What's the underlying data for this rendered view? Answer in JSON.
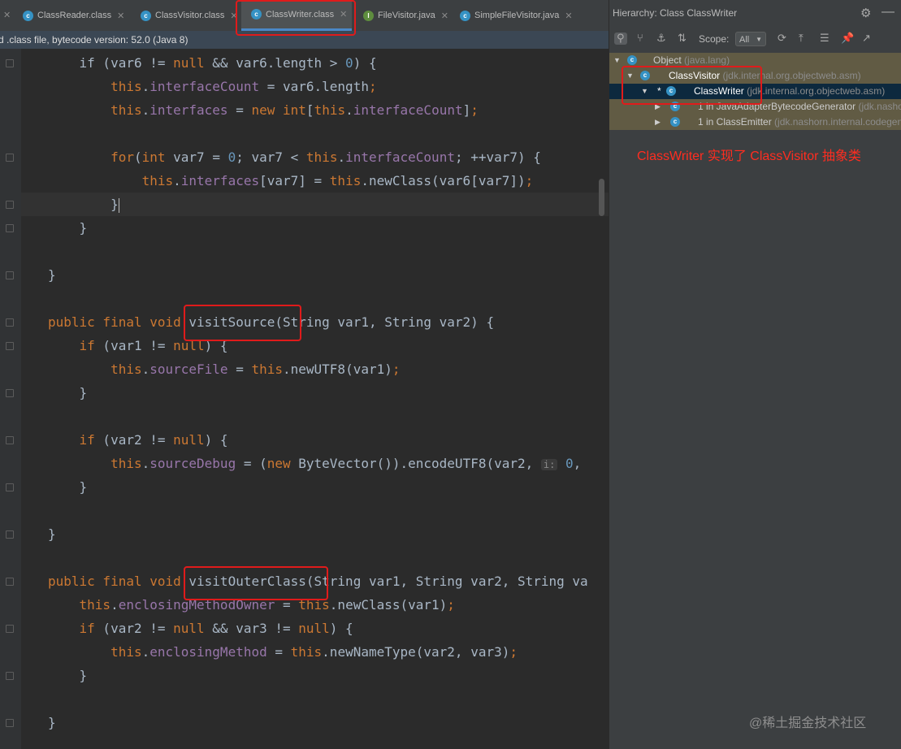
{
  "tabs": [
    {
      "label": "ClassReader.class",
      "kind": "class",
      "active": false
    },
    {
      "label": "ClassVisitor.class",
      "kind": "class",
      "active": false
    },
    {
      "label": "ClassWriter.class",
      "kind": "class",
      "active": true
    },
    {
      "label": "FileVisitor.java",
      "kind": "java",
      "active": false
    },
    {
      "label": "SimpleFileVisitor.java",
      "kind": "java",
      "active": false
    }
  ],
  "info_bar": "d .class file, bytecode version: 52.0 (Java 8)",
  "code_lines": [
    [
      [
        "    ",
        ""
      ],
      [
        "if",
        ""
      ],
      [
        " (var6 != ",
        ""
      ],
      [
        "null",
        "k"
      ],
      [
        " && var6.length > ",
        ""
      ],
      [
        "0",
        "n"
      ],
      [
        ") {",
        ""
      ]
    ],
    [
      [
        "        ",
        ""
      ],
      [
        "this",
        "k"
      ],
      [
        ".",
        ""
      ],
      [
        "interfaceCount",
        "f"
      ],
      [
        " = var6.length",
        ""
      ],
      [
        ";",
        "k"
      ]
    ],
    [
      [
        "        ",
        ""
      ],
      [
        "this",
        "k"
      ],
      [
        ".",
        ""
      ],
      [
        "interfaces",
        "f"
      ],
      [
        " = ",
        ""
      ],
      [
        "new",
        "k"
      ],
      [
        " ",
        ""
      ],
      [
        "int",
        "k"
      ],
      [
        "[",
        ""
      ],
      [
        "this",
        "k"
      ],
      [
        ".",
        ""
      ],
      [
        "interfaceCount",
        "f"
      ],
      [
        "]",
        ""
      ],
      [
        ";",
        "k"
      ]
    ],
    [],
    [
      [
        "        ",
        ""
      ],
      [
        "for",
        "k"
      ],
      [
        "(",
        ""
      ],
      [
        "int",
        "k"
      ],
      [
        " var7 = ",
        ""
      ],
      [
        "0",
        "n"
      ],
      [
        "; var7 < ",
        ""
      ],
      [
        "this",
        "k"
      ],
      [
        ".",
        ""
      ],
      [
        "interfaceCount",
        "f"
      ],
      [
        "; ++var7) {",
        ""
      ]
    ],
    [
      [
        "            ",
        ""
      ],
      [
        "this",
        "k"
      ],
      [
        ".",
        ""
      ],
      [
        "interfaces",
        "f"
      ],
      [
        "[var7] = ",
        ""
      ],
      [
        "this",
        "k"
      ],
      [
        ".newClass(var6[var7])",
        ""
      ],
      [
        ";",
        "k"
      ]
    ],
    [
      [
        "        }",
        ""
      ]
    ],
    [
      [
        "    }",
        ""
      ]
    ],
    [],
    [
      [
        "}",
        ""
      ]
    ],
    [],
    [
      [
        "public final void",
        "k"
      ],
      [
        " visitSource(String var1, String var2) {",
        ""
      ]
    ],
    [
      [
        "    ",
        ""
      ],
      [
        "if",
        "k"
      ],
      [
        " (var1 != ",
        ""
      ],
      [
        "null",
        "k"
      ],
      [
        ") {",
        ""
      ]
    ],
    [
      [
        "        ",
        ""
      ],
      [
        "this",
        "k"
      ],
      [
        ".",
        ""
      ],
      [
        "sourceFile",
        "f"
      ],
      [
        " = ",
        ""
      ],
      [
        "this",
        "k"
      ],
      [
        ".newUTF8(var1)",
        ""
      ],
      [
        ";",
        "k"
      ]
    ],
    [
      [
        "    }",
        ""
      ]
    ],
    [],
    [
      [
        "    ",
        ""
      ],
      [
        "if",
        "k"
      ],
      [
        " (var2 != ",
        ""
      ],
      [
        "null",
        "k"
      ],
      [
        ") {",
        ""
      ]
    ],
    [
      [
        "        ",
        ""
      ],
      [
        "this",
        "k"
      ],
      [
        ".",
        ""
      ],
      [
        "sourceDebug",
        "f"
      ],
      [
        " = (",
        ""
      ],
      [
        "new",
        "k"
      ],
      [
        " ByteVector()).encodeUTF8(var2, ",
        ""
      ],
      [
        "i:",
        "hint"
      ],
      [
        " ",
        ""
      ],
      [
        "0",
        "n"
      ],
      [
        ",",
        ""
      ]
    ],
    [
      [
        "    }",
        ""
      ]
    ],
    [],
    [
      [
        "}",
        ""
      ]
    ],
    [],
    [
      [
        "public final void",
        "k"
      ],
      [
        " visitOuterClass(String var1, String var2, String va",
        ""
      ]
    ],
    [
      [
        "    ",
        ""
      ],
      [
        "this",
        "k"
      ],
      [
        ".",
        ""
      ],
      [
        "enclosingMethodOwner",
        "f"
      ],
      [
        " = ",
        ""
      ],
      [
        "this",
        "k"
      ],
      [
        ".newClass(var1)",
        ""
      ],
      [
        ";",
        "k"
      ]
    ],
    [
      [
        "    ",
        ""
      ],
      [
        "if",
        "k"
      ],
      [
        " (var2 != ",
        ""
      ],
      [
        "null",
        "k"
      ],
      [
        " && var3 != ",
        ""
      ],
      [
        "null",
        "k"
      ],
      [
        ") {",
        ""
      ]
    ],
    [
      [
        "        ",
        ""
      ],
      [
        "this",
        "k"
      ],
      [
        ".",
        ""
      ],
      [
        "enclosingMethod",
        "f"
      ],
      [
        " = ",
        ""
      ],
      [
        "this",
        "k"
      ],
      [
        ".newNameType(var2, var3)",
        ""
      ],
      [
        ";",
        "k"
      ]
    ],
    [
      [
        "    }",
        ""
      ]
    ],
    [],
    [
      [
        "}",
        ""
      ]
    ]
  ],
  "hierarchy": {
    "title": "Hierarchy:  Class ClassWriter",
    "scope_label": "Scope:",
    "scope_value": "All",
    "rows": [
      {
        "name": "Object",
        "pkg": "(java.lang)"
      },
      {
        "name": "ClassVisitor",
        "pkg": "(jdk.internal.org.objectweb.asm)"
      },
      {
        "name": "ClassWriter",
        "pkg": "(jdk.internal.org.objectweb.asm)",
        "prefix": "*"
      },
      {
        "name": "1 in JavaAdapterBytecodeGenerator",
        "pkg": "(jdk.nashorn.internal)"
      },
      {
        "name": "1 in ClassEmitter",
        "pkg": "(jdk.nashorn.internal.codegen)"
      }
    ]
  },
  "annotation": "ClassWriter 实现了 ClassVisitor 抽象类",
  "watermark": "@稀土掘金技术社区",
  "colors": {
    "annotation": "#ff2d20",
    "highlight_box": "#e01b1b",
    "selection": "#0d293e"
  }
}
